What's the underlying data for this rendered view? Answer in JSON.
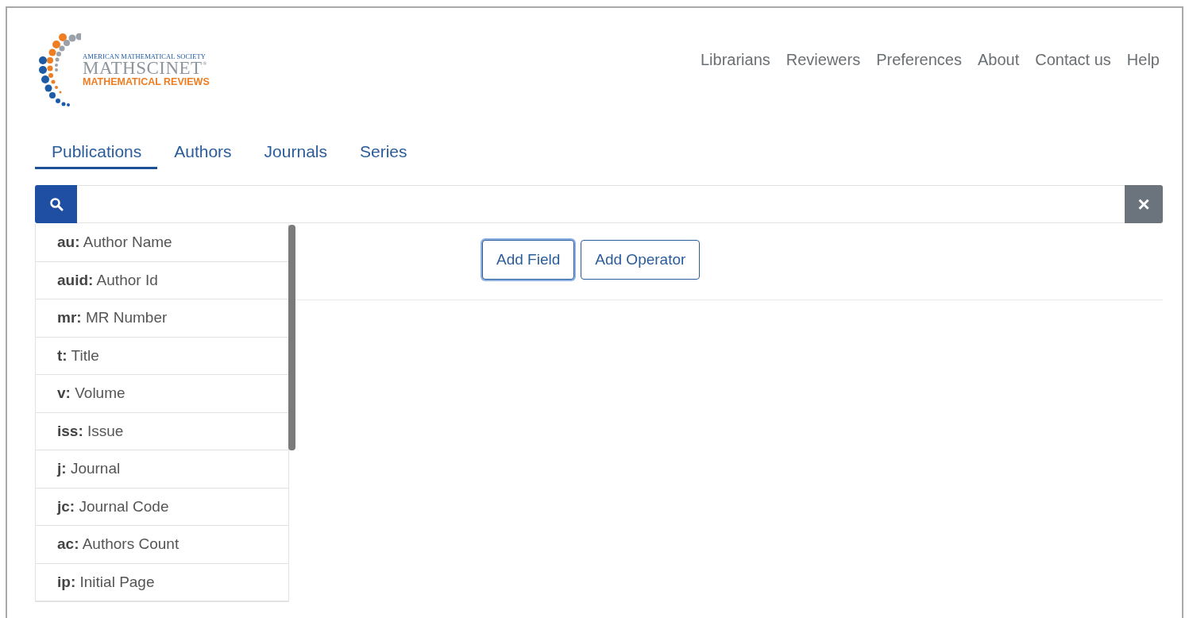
{
  "logo": {
    "society": "AMERICAN MATHEMATICAL SOCIETY",
    "product": "MATHSCINET",
    "mark": "®",
    "subtitle": "MATHEMATICAL REVIEWS"
  },
  "top_nav": [
    "Librarians",
    "Reviewers",
    "Preferences",
    "About",
    "Contact us",
    "Help"
  ],
  "tabs": [
    {
      "label": "Publications",
      "selected": true
    },
    {
      "label": "Authors",
      "selected": false
    },
    {
      "label": "Journals",
      "selected": false
    },
    {
      "label": "Series",
      "selected": false
    }
  ],
  "search": {
    "clear_button": "×"
  },
  "field_menu": [
    {
      "label": "**au:** Author Name"
    },
    {
      "label": "**auid:** Author Id"
    },
    {
      "label": "**mr:** MR Number"
    },
    {
      "label": "**t:** Title"
    },
    {
      "label": "**v:** Volume"
    },
    {
      "label": "**iss:** Issue"
    },
    {
      "label": "**j:** Journal"
    },
    {
      "label": "**jc:** Journal Code"
    },
    {
      "label": "**ac:** Authors Count"
    },
    {
      "label": "**ip:** Initial Page"
    }
  ],
  "buttons": [
    {
      "label": "Add Field",
      "selected": true
    },
    {
      "label": "Add Operator",
      "selected": false
    }
  ]
}
